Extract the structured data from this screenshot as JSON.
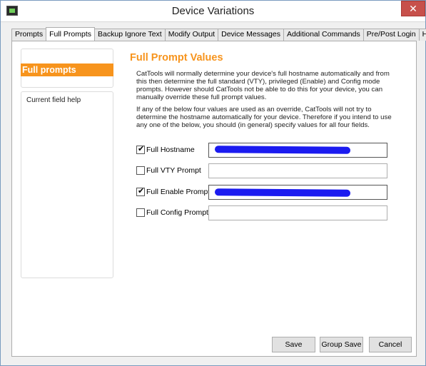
{
  "window": {
    "title": "Device Variations",
    "close_glyph": "✕"
  },
  "tabs": [
    {
      "label": "Prompts",
      "active": false
    },
    {
      "label": "Full Prompts",
      "active": true
    },
    {
      "label": "Backup Ignore Text",
      "active": false
    },
    {
      "label": "Modify Output",
      "active": false
    },
    {
      "label": "Device Messages",
      "active": false
    },
    {
      "label": "Additional Commands",
      "active": false
    },
    {
      "label": "Pre/Post Login",
      "active": false
    },
    {
      "label": "Help",
      "active": false
    }
  ],
  "sidebar": {
    "heading": "Full prompts",
    "help_label": "Current field help",
    "accent": "#f7941d"
  },
  "main": {
    "title": "Full Prompt Values",
    "para1": "CatTools will normally determine your device's full hostname automatically and from this then determine the full standard (VTY), privileged (Enable) and Config mode prompts. However should CatTools not be able to do this for your device, you can manually override these full prompt values.",
    "para2": "If any of the below four values are used as an override, CatTools will not try to determine the hostname automatically for your device. Therefore if you intend to use any one of the below, you should (in general) specify values for all four fields.",
    "fields": [
      {
        "label": "Full Hostname",
        "checked": true,
        "value": ""
      },
      {
        "label": "Full VTY Prompt",
        "checked": false,
        "value": ""
      },
      {
        "label": "Full Enable Prompt",
        "checked": true,
        "value": ""
      },
      {
        "label": "Full Config Prompt",
        "checked": false,
        "value": ""
      }
    ]
  },
  "buttons": {
    "save": "Save",
    "group_save": "Group Save",
    "cancel": "Cancel"
  }
}
